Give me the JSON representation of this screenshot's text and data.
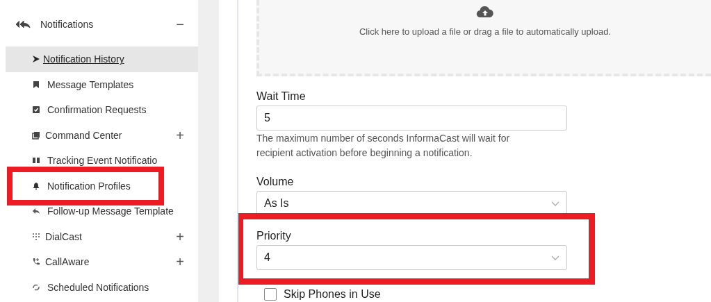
{
  "sidebar": {
    "header": {
      "label": "Notifications",
      "toggle": "−"
    },
    "items": [
      {
        "label": "Notification History",
        "selected": true,
        "highlighted": false
      },
      {
        "label": "Message Templates",
        "selected": false,
        "highlighted": false
      },
      {
        "label": "Confirmation Requests",
        "selected": false,
        "highlighted": false
      },
      {
        "label": "Command Center",
        "toggle": "+",
        "selected": false,
        "highlighted": false
      },
      {
        "label": "Tracking Event Notificatio",
        "selected": false,
        "highlighted": false
      },
      {
        "label": "Notification Profiles",
        "selected": false,
        "highlighted": true
      },
      {
        "label": "Follow-up Message Template",
        "selected": false,
        "highlighted": false
      },
      {
        "label": "DialCast",
        "toggle": "+",
        "selected": false,
        "highlighted": false
      },
      {
        "label": "CallAware",
        "toggle": "+",
        "selected": false,
        "highlighted": false
      },
      {
        "label": "Scheduled Notifications",
        "selected": false,
        "highlighted": false
      }
    ]
  },
  "upload": {
    "text": "Click here to upload a file or drag a file to automatically upload."
  },
  "fields": [
    {
      "kind": "text",
      "label": "Wait Time",
      "value": "5",
      "help": "The maximum number of seconds InformaCast will wait for recipient activation before beginning a notification.",
      "highlighted": false
    },
    {
      "kind": "select",
      "label": "Volume",
      "value": "As Is",
      "highlighted": false
    },
    {
      "kind": "select",
      "label": "Priority",
      "value": "4",
      "highlighted": true
    },
    {
      "kind": "checkbox",
      "label": "Skip Phones in Use",
      "checked": false
    }
  ]
}
